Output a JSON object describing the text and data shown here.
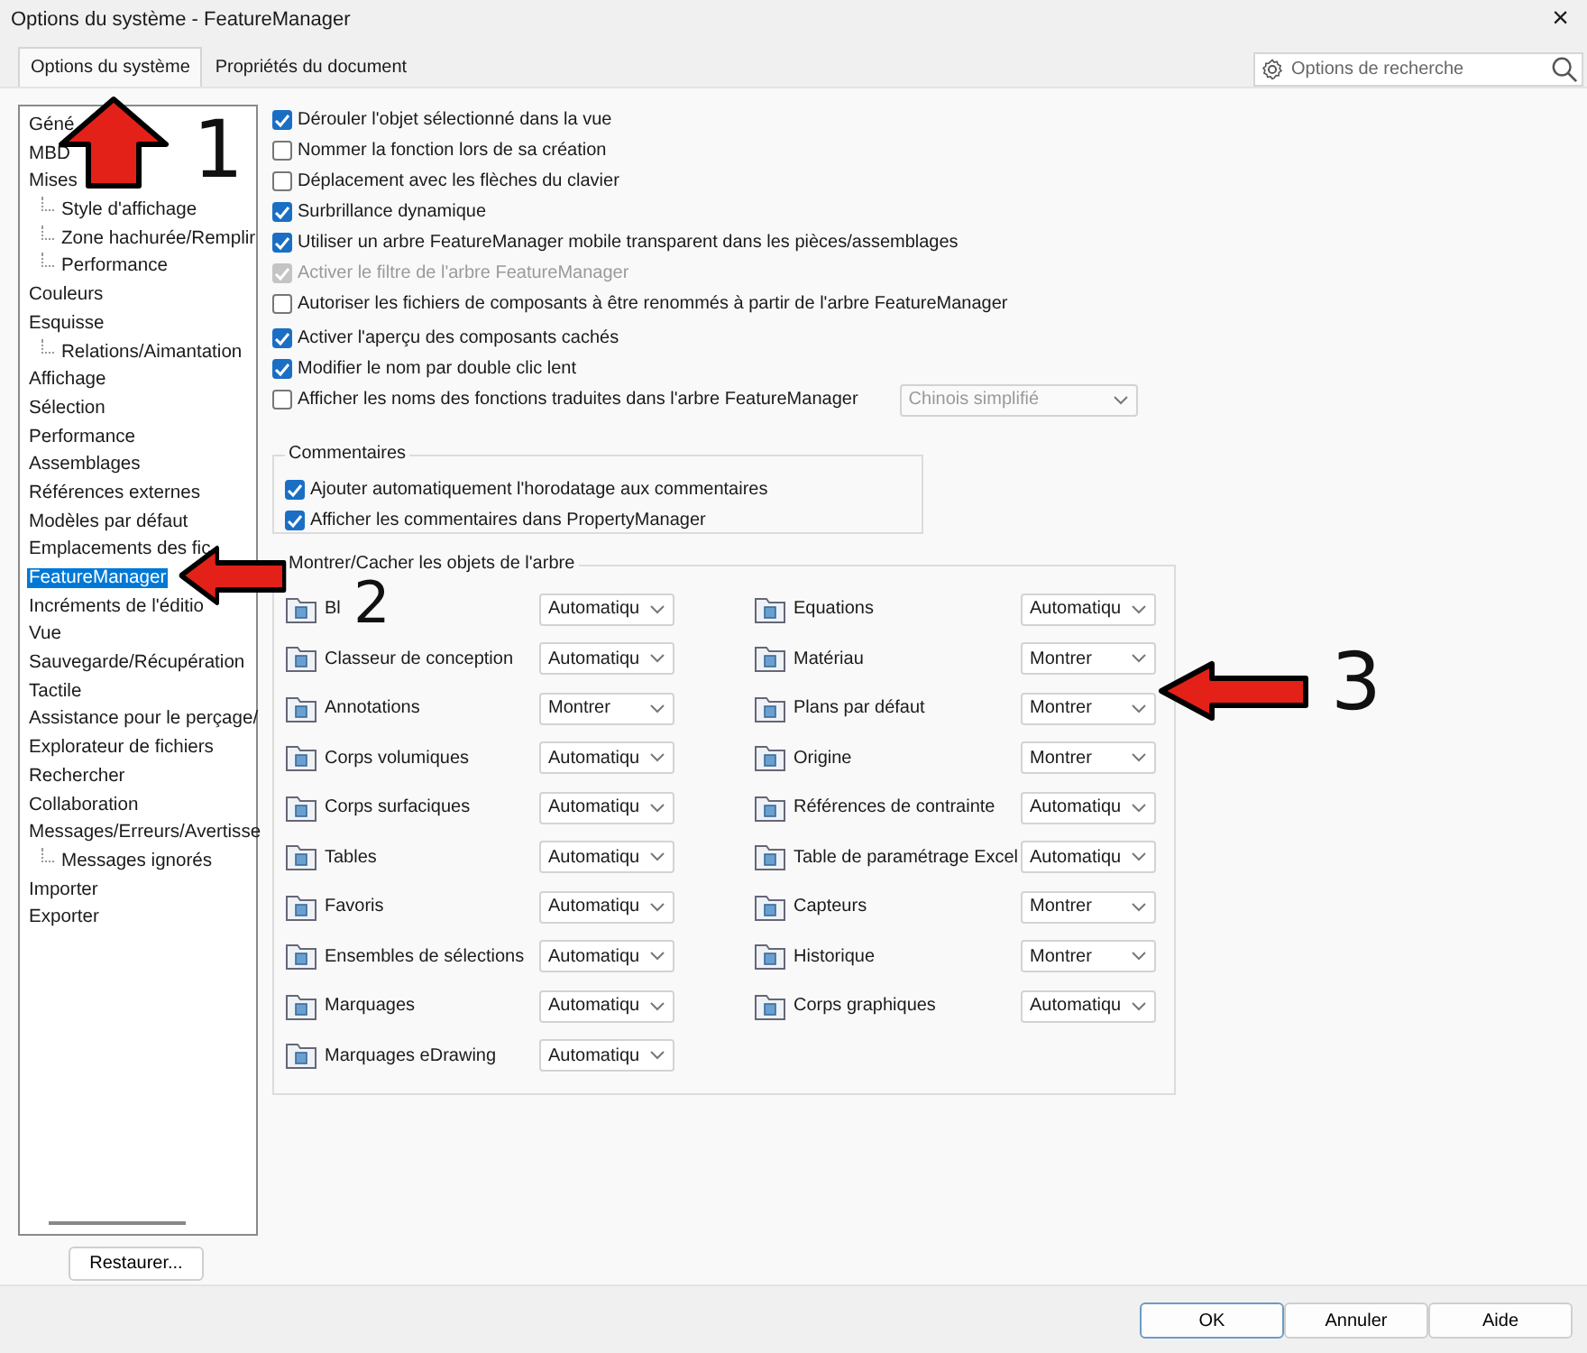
{
  "window": {
    "title": "Options du système - FeatureManager",
    "close": "×"
  },
  "tabs": [
    {
      "label": "Options du système",
      "selected": true
    },
    {
      "label": "Propriétés du document",
      "selected": false
    }
  ],
  "search": {
    "placeholder": "Options de recherche"
  },
  "tree": [
    {
      "label": "Géné",
      "selected": false
    },
    {
      "label": "MBD",
      "selected": false
    },
    {
      "label": "Mises",
      "selected": false,
      "children": [
        {
          "label": "Style d'affichage",
          "selected": false
        },
        {
          "label": "Zone hachurée/Remplir",
          "selected": false
        },
        {
          "label": "Performance",
          "selected": false
        }
      ]
    },
    {
      "label": "Couleurs",
      "selected": false
    },
    {
      "label": "Esquisse",
      "selected": false,
      "children": [
        {
          "label": "Relations/Aimantation",
          "selected": false
        }
      ]
    },
    {
      "label": "Affichage",
      "selected": false
    },
    {
      "label": "Sélection",
      "selected": false
    },
    {
      "label": "Performance",
      "selected": false
    },
    {
      "label": "Assemblages",
      "selected": false
    },
    {
      "label": "Références externes",
      "selected": false
    },
    {
      "label": "Modèles par défaut",
      "selected": false
    },
    {
      "label": "Emplacements des fic",
      "selected": false
    },
    {
      "label": "FeatureManager",
      "selected": true
    },
    {
      "label": "Incréments de l'éditio",
      "selected": false
    },
    {
      "label": "Vue",
      "selected": false
    },
    {
      "label": "Sauvegarde/Récupération",
      "selected": false
    },
    {
      "label": "Tactile",
      "selected": false
    },
    {
      "label": "Assistance pour le perçage/",
      "selected": false
    },
    {
      "label": "Explorateur de fichiers",
      "selected": false
    },
    {
      "label": "Rechercher",
      "selected": false
    },
    {
      "label": "Collaboration",
      "selected": false
    },
    {
      "label": "Messages/Erreurs/Avertisse",
      "selected": false,
      "children": [
        {
          "label": "Messages ignorés",
          "selected": false
        }
      ]
    },
    {
      "label": "Importer",
      "selected": false
    },
    {
      "label": "Exporter",
      "selected": false
    }
  ],
  "restore_button": "Restaurer...",
  "option_groups": [
    [
      {
        "label": "Dérouler l'objet sélectionné dans la vue",
        "checked": true,
        "disabled": false
      },
      {
        "label": "Nommer la fonction lors de sa création",
        "checked": false,
        "disabled": false
      },
      {
        "label": "Déplacement avec les flèches du clavier",
        "checked": false,
        "disabled": false
      },
      {
        "label": "Surbrillance dynamique",
        "checked": true,
        "disabled": false
      },
      {
        "label": "Utiliser un arbre FeatureManager mobile transparent dans les pièces/assemblages",
        "checked": true,
        "disabled": false
      },
      {
        "label": "Activer le filtre de l'arbre FeatureManager",
        "checked": true,
        "disabled": true
      },
      {
        "label": "Autoriser les fichiers de composants à être renommés à partir de l'arbre FeatureManager",
        "checked": false,
        "disabled": false
      }
    ],
    [
      {
        "label": "Activer l'aperçu des composants cachés",
        "checked": true,
        "disabled": false
      },
      {
        "label": "Modifier le nom par double clic lent",
        "checked": true,
        "disabled": false
      },
      {
        "label": "Afficher les noms des fonctions traduites dans l'arbre FeatureManager",
        "checked": false,
        "disabled": false,
        "dropdown": {
          "value": "Chinois simplifié",
          "disabled": true
        }
      }
    ]
  ],
  "comments": {
    "title": "Commentaires",
    "options": [
      {
        "label": "Ajouter automatiquement l'horodatage aux commentaires",
        "checked": true,
        "disabled": false
      },
      {
        "label": "Afficher les commentaires dans PropertyManager",
        "checked": true,
        "disabled": false
      }
    ]
  },
  "tree_objects": {
    "title": "Montrer/Cacher les objets de l'arbre",
    "columns": [
      [
        {
          "label": "Bl",
          "value": "Automatiqu"
        },
        {
          "label": "Classeur de conception",
          "value": "Automatiqu"
        },
        {
          "label": "Annotations",
          "value": "Montrer"
        },
        {
          "label": "Corps volumiques",
          "value": "Automatiqu"
        },
        {
          "label": "Corps surfaciques",
          "value": "Automatiqu"
        },
        {
          "label": "Tables",
          "value": "Automatiqu"
        },
        {
          "label": "Favoris",
          "value": "Automatiqu"
        },
        {
          "label": "Ensembles de sélections",
          "value": "Automatiqu"
        },
        {
          "label": "Marquages",
          "value": "Automatiqu"
        },
        {
          "label": "Marquages eDrawing",
          "value": "Automatiqu"
        }
      ],
      [
        {
          "label": "Equations",
          "value": "Automatiqu"
        },
        {
          "label": "Matériau",
          "value": "Montrer"
        },
        {
          "label": "Plans par défaut",
          "value": "Montrer"
        },
        {
          "label": "Origine",
          "value": "Montrer"
        },
        {
          "label": "Références de contrainte",
          "value": "Automatiqu"
        },
        {
          "label": "Table de paramétrage Excel",
          "value": "Automatiqu"
        },
        {
          "label": "Capteurs",
          "value": "Montrer"
        },
        {
          "label": "Historique",
          "value": "Montrer"
        },
        {
          "label": "Corps graphiques",
          "value": "Automatiqu"
        }
      ]
    ]
  },
  "buttons": [
    {
      "label": "OK",
      "default": true
    },
    {
      "label": "Annuler",
      "default": false
    },
    {
      "label": "Aide",
      "default": false
    }
  ],
  "annotations": [
    {
      "label": "1",
      "kind": "up"
    },
    {
      "label": "2",
      "kind": "left"
    },
    {
      "label": "3",
      "kind": "left"
    }
  ]
}
